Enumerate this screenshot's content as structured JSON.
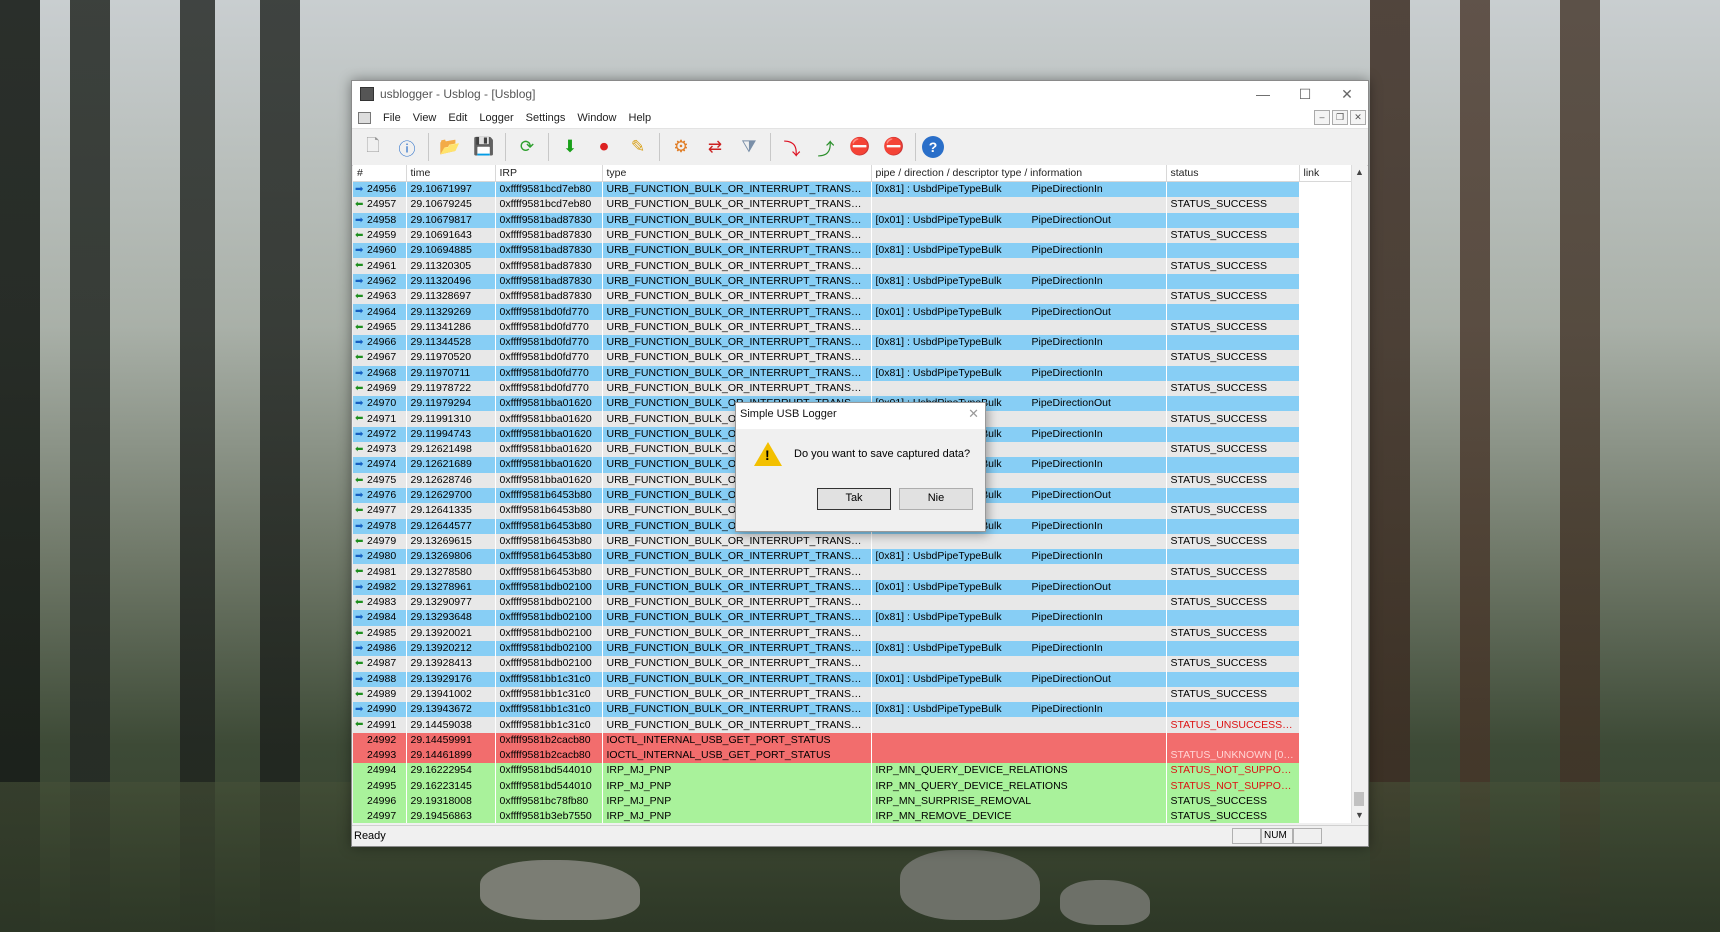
{
  "window": {
    "title": "usblogger - Usblog - [Usblog]",
    "controls": [
      "—",
      "☐",
      "✕"
    ]
  },
  "menu": [
    "File",
    "View",
    "Edit",
    "Logger",
    "Settings",
    "Window",
    "Help"
  ],
  "mdi_controls": [
    "–",
    "❐",
    "✕"
  ],
  "columns": [
    "#",
    "time",
    "IRP",
    "type",
    "pipe / direction / descriptor type / information",
    "status",
    "link"
  ],
  "rows": [
    {
      "n": "24956",
      "t": "29.10671997",
      "irp": "0xffff9581bcd7eb80",
      "type": "URB_FUNCTION_BULK_OR_INTERRUPT_TRANSFER",
      "info": "[0x81] : UsbdPipeTypeBulk",
      "dir": "PipeDirectionIn",
      "status": "",
      "c": "blue"
    },
    {
      "n": "24957",
      "t": "29.10679245",
      "irp": "0xffff9581bcd7eb80",
      "type": "URB_FUNCTION_BULK_OR_INTERRUPT_TRANSFER",
      "info": "",
      "dir": "",
      "status": "STATUS_SUCCESS",
      "c": "gray"
    },
    {
      "n": "24958",
      "t": "29.10679817",
      "irp": "0xffff9581bad87830",
      "type": "URB_FUNCTION_BULK_OR_INTERRUPT_TRANSFER",
      "info": "[0x01] : UsbdPipeTypeBulk",
      "dir": "PipeDirectionOut",
      "status": "",
      "c": "blue"
    },
    {
      "n": "24959",
      "t": "29.10691643",
      "irp": "0xffff9581bad87830",
      "type": "URB_FUNCTION_BULK_OR_INTERRUPT_TRANSFER",
      "info": "",
      "dir": "",
      "status": "STATUS_SUCCESS",
      "c": "gray"
    },
    {
      "n": "24960",
      "t": "29.10694885",
      "irp": "0xffff9581bad87830",
      "type": "URB_FUNCTION_BULK_OR_INTERRUPT_TRANSFER",
      "info": "[0x81] : UsbdPipeTypeBulk",
      "dir": "PipeDirectionIn",
      "status": "",
      "c": "blue"
    },
    {
      "n": "24961",
      "t": "29.11320305",
      "irp": "0xffff9581bad87830",
      "type": "URB_FUNCTION_BULK_OR_INTERRUPT_TRANSFER",
      "info": "",
      "dir": "",
      "status": "STATUS_SUCCESS",
      "c": "gray"
    },
    {
      "n": "24962",
      "t": "29.11320496",
      "irp": "0xffff9581bad87830",
      "type": "URB_FUNCTION_BULK_OR_INTERRUPT_TRANSFER",
      "info": "[0x81] : UsbdPipeTypeBulk",
      "dir": "PipeDirectionIn",
      "status": "",
      "c": "blue"
    },
    {
      "n": "24963",
      "t": "29.11328697",
      "irp": "0xffff9581bad87830",
      "type": "URB_FUNCTION_BULK_OR_INTERRUPT_TRANSFER",
      "info": "",
      "dir": "",
      "status": "STATUS_SUCCESS",
      "c": "gray"
    },
    {
      "n": "24964",
      "t": "29.11329269",
      "irp": "0xffff9581bd0fd770",
      "type": "URB_FUNCTION_BULK_OR_INTERRUPT_TRANSFER",
      "info": "[0x01] : UsbdPipeTypeBulk",
      "dir": "PipeDirectionOut",
      "status": "",
      "c": "blue"
    },
    {
      "n": "24965",
      "t": "29.11341286",
      "irp": "0xffff9581bd0fd770",
      "type": "URB_FUNCTION_BULK_OR_INTERRUPT_TRANSFER",
      "info": "",
      "dir": "",
      "status": "STATUS_SUCCESS",
      "c": "gray"
    },
    {
      "n": "24966",
      "t": "29.11344528",
      "irp": "0xffff9581bd0fd770",
      "type": "URB_FUNCTION_BULK_OR_INTERRUPT_TRANSFER",
      "info": "[0x81] : UsbdPipeTypeBulk",
      "dir": "PipeDirectionIn",
      "status": "",
      "c": "blue"
    },
    {
      "n": "24967",
      "t": "29.11970520",
      "irp": "0xffff9581bd0fd770",
      "type": "URB_FUNCTION_BULK_OR_INTERRUPT_TRANSFER",
      "info": "",
      "dir": "",
      "status": "STATUS_SUCCESS",
      "c": "gray"
    },
    {
      "n": "24968",
      "t": "29.11970711",
      "irp": "0xffff9581bd0fd770",
      "type": "URB_FUNCTION_BULK_OR_INTERRUPT_TRANSFER",
      "info": "[0x81] : UsbdPipeTypeBulk",
      "dir": "PipeDirectionIn",
      "status": "",
      "c": "blue"
    },
    {
      "n": "24969",
      "t": "29.11978722",
      "irp": "0xffff9581bd0fd770",
      "type": "URB_FUNCTION_BULK_OR_INTERRUPT_TRANSFER",
      "info": "",
      "dir": "",
      "status": "STATUS_SUCCESS",
      "c": "gray"
    },
    {
      "n": "24970",
      "t": "29.11979294",
      "irp": "0xffff9581bba01620",
      "type": "URB_FUNCTION_BULK_OR_INTERRUPT_TRANSFER",
      "info": "[0x01] : UsbdPipeTypeBulk",
      "dir": "PipeDirectionOut",
      "status": "",
      "c": "blue"
    },
    {
      "n": "24971",
      "t": "29.11991310",
      "irp": "0xffff9581bba01620",
      "type": "URB_FUNCTION_BULK_OR_INTERRUPT_TRANSFER",
      "info": "",
      "dir": "",
      "status": "STATUS_SUCCESS",
      "c": "gray"
    },
    {
      "n": "24972",
      "t": "29.11994743",
      "irp": "0xffff9581bba01620",
      "type": "URB_FUNCTION_BULK_OR_INTERRUPT_TRANSFER",
      "info": "[0x81] : UsbdPipeTypeBulk",
      "dir": "PipeDirectionIn",
      "status": "",
      "c": "blue"
    },
    {
      "n": "24973",
      "t": "29.12621498",
      "irp": "0xffff9581bba01620",
      "type": "URB_FUNCTION_BULK_OR_INTERRUPT_TRANSFER",
      "info": "",
      "dir": "",
      "status": "STATUS_SUCCESS",
      "c": "gray"
    },
    {
      "n": "24974",
      "t": "29.12621689",
      "irp": "0xffff9581bba01620",
      "type": "URB_FUNCTION_BULK_OR_INTERRUPT_TRANSFER",
      "info": "[0x81] : UsbdPipeTypeBulk",
      "dir": "PipeDirectionIn",
      "status": "",
      "c": "blue"
    },
    {
      "n": "24975",
      "t": "29.12628746",
      "irp": "0xffff9581bba01620",
      "type": "URB_FUNCTION_BULK_OR_INTERRUPT_TRANSFER",
      "info": "",
      "dir": "",
      "status": "STATUS_SUCCESS",
      "c": "gray"
    },
    {
      "n": "24976",
      "t": "29.12629700",
      "irp": "0xffff9581b6453b80",
      "type": "URB_FUNCTION_BULK_OR_INTERRUPT_TRANSFER",
      "info": "[0x01] : UsbdPipeTypeBulk",
      "dir": "PipeDirectionOut",
      "status": "",
      "c": "blue"
    },
    {
      "n": "24977",
      "t": "29.12641335",
      "irp": "0xffff9581b6453b80",
      "type": "URB_FUNCTION_BULK_OR_INTERRUPT_TRANSFER",
      "info": "",
      "dir": "",
      "status": "STATUS_SUCCESS",
      "c": "gray"
    },
    {
      "n": "24978",
      "t": "29.12644577",
      "irp": "0xffff9581b6453b80",
      "type": "URB_FUNCTION_BULK_OR_INTERRUPT_TRANSFER",
      "info": "[0x81] : UsbdPipeTypeBulk",
      "dir": "PipeDirectionIn",
      "status": "",
      "c": "blue"
    },
    {
      "n": "24979",
      "t": "29.13269615",
      "irp": "0xffff9581b6453b80",
      "type": "URB_FUNCTION_BULK_OR_INTERRUPT_TRANSFER",
      "info": "",
      "dir": "",
      "status": "STATUS_SUCCESS",
      "c": "gray"
    },
    {
      "n": "24980",
      "t": "29.13269806",
      "irp": "0xffff9581b6453b80",
      "type": "URB_FUNCTION_BULK_OR_INTERRUPT_TRANSFER",
      "info": "[0x81] : UsbdPipeTypeBulk",
      "dir": "PipeDirectionIn",
      "status": "",
      "c": "blue"
    },
    {
      "n": "24981",
      "t": "29.13278580",
      "irp": "0xffff9581b6453b80",
      "type": "URB_FUNCTION_BULK_OR_INTERRUPT_TRANSFER",
      "info": "",
      "dir": "",
      "status": "STATUS_SUCCESS",
      "c": "gray"
    },
    {
      "n": "24982",
      "t": "29.13278961",
      "irp": "0xffff9581bdb02100",
      "type": "URB_FUNCTION_BULK_OR_INTERRUPT_TRANSFER",
      "info": "[0x01] : UsbdPipeTypeBulk",
      "dir": "PipeDirectionOut",
      "status": "",
      "c": "blue"
    },
    {
      "n": "24983",
      "t": "29.13290977",
      "irp": "0xffff9581bdb02100",
      "type": "URB_FUNCTION_BULK_OR_INTERRUPT_TRANSFER",
      "info": "",
      "dir": "",
      "status": "STATUS_SUCCESS",
      "c": "gray"
    },
    {
      "n": "24984",
      "t": "29.13293648",
      "irp": "0xffff9581bdb02100",
      "type": "URB_FUNCTION_BULK_OR_INTERRUPT_TRANSFER",
      "info": "[0x81] : UsbdPipeTypeBulk",
      "dir": "PipeDirectionIn",
      "status": "",
      "c": "blue"
    },
    {
      "n": "24985",
      "t": "29.13920021",
      "irp": "0xffff9581bdb02100",
      "type": "URB_FUNCTION_BULK_OR_INTERRUPT_TRANSFER",
      "info": "",
      "dir": "",
      "status": "STATUS_SUCCESS",
      "c": "gray"
    },
    {
      "n": "24986",
      "t": "29.13920212",
      "irp": "0xffff9581bdb02100",
      "type": "URB_FUNCTION_BULK_OR_INTERRUPT_TRANSFER",
      "info": "[0x81] : UsbdPipeTypeBulk",
      "dir": "PipeDirectionIn",
      "status": "",
      "c": "blue"
    },
    {
      "n": "24987",
      "t": "29.13928413",
      "irp": "0xffff9581bdb02100",
      "type": "URB_FUNCTION_BULK_OR_INTERRUPT_TRANSFER",
      "info": "",
      "dir": "",
      "status": "STATUS_SUCCESS",
      "c": "gray"
    },
    {
      "n": "24988",
      "t": "29.13929176",
      "irp": "0xffff9581bb1c31c0",
      "type": "URB_FUNCTION_BULK_OR_INTERRUPT_TRANSFER",
      "info": "[0x01] : UsbdPipeTypeBulk",
      "dir": "PipeDirectionOut",
      "status": "",
      "c": "blue"
    },
    {
      "n": "24989",
      "t": "29.13941002",
      "irp": "0xffff9581bb1c31c0",
      "type": "URB_FUNCTION_BULK_OR_INTERRUPT_TRANSFER",
      "info": "",
      "dir": "",
      "status": "STATUS_SUCCESS",
      "c": "gray"
    },
    {
      "n": "24990",
      "t": "29.13943672",
      "irp": "0xffff9581bb1c31c0",
      "type": "URB_FUNCTION_BULK_OR_INTERRUPT_TRANSFER",
      "info": "[0x81] : UsbdPipeTypeBulk",
      "dir": "PipeDirectionIn",
      "status": "",
      "c": "blue"
    },
    {
      "n": "24991",
      "t": "29.14459038",
      "irp": "0xffff9581bb1c31c0",
      "type": "URB_FUNCTION_BULK_OR_INTERRUPT_TRANSFER",
      "info": "",
      "dir": "",
      "status": "STATUS_UNSUCCESSFUL",
      "c": "gray",
      "st": "red"
    },
    {
      "n": "24992",
      "t": "29.14459991",
      "irp": "0xffff9581b2cacb80",
      "type": "IOCTL_INTERNAL_USB_GET_PORT_STATUS",
      "info": "",
      "dir": "",
      "status": "",
      "c": "red"
    },
    {
      "n": "24993",
      "t": "29.14461899",
      "irp": "0xffff9581b2cacb80",
      "type": "IOCTL_INTERNAL_USB_GET_PORT_STATUS",
      "info": "",
      "dir": "",
      "status": "STATUS_UNKNOWN [0x...",
      "c": "red",
      "st": "red-light"
    },
    {
      "n": "24994",
      "t": "29.16222954",
      "irp": "0xffff9581bd544010",
      "type": "IRP_MJ_PNP",
      "info": "IRP_MN_QUERY_DEVICE_RELATIONS",
      "dir": "",
      "status": "STATUS_NOT_SUPPORT...",
      "c": "green",
      "st": "red"
    },
    {
      "n": "24995",
      "t": "29.16223145",
      "irp": "0xffff9581bd544010",
      "type": "IRP_MJ_PNP",
      "info": "IRP_MN_QUERY_DEVICE_RELATIONS",
      "dir": "",
      "status": "STATUS_NOT_SUPPORT...",
      "c": "green",
      "st": "red"
    },
    {
      "n": "24996",
      "t": "29.19318008",
      "irp": "0xffff9581bc78fb80",
      "type": "IRP_MJ_PNP",
      "info": "IRP_MN_SURPRISE_REMOVAL",
      "dir": "",
      "status": "STATUS_SUCCESS",
      "c": "green"
    },
    {
      "n": "24997",
      "t": "29.19456863",
      "irp": "0xffff9581b3eb7550",
      "type": "IRP_MJ_PNP",
      "info": "IRP_MN_REMOVE_DEVICE",
      "dir": "",
      "status": "STATUS_SUCCESS",
      "c": "green"
    }
  ],
  "status_bar": {
    "text": "Ready",
    "num": "NUM"
  },
  "dialog": {
    "title": "Simple USB Logger",
    "message": "Do you want to save captured data?",
    "yes": "Tak",
    "no": "Nie"
  },
  "colors": {
    "row_blue": "#87cef5",
    "row_gray": "#e8e8e8",
    "row_red": "#f26d6d",
    "row_green": "#a9f29b"
  }
}
